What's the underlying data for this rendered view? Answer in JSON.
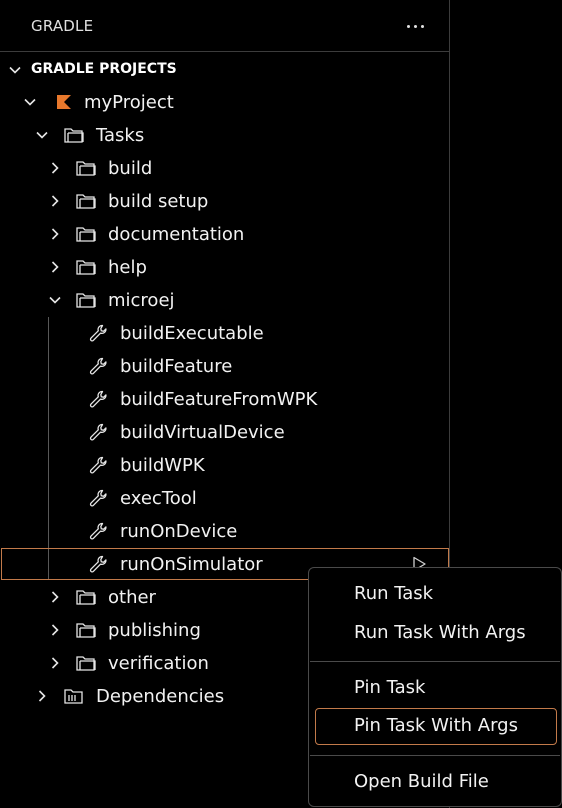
{
  "panel": {
    "title": "GRADLE",
    "more_icon": "ellipsis-icon"
  },
  "section": {
    "title": "GRADLE PROJECTS"
  },
  "tree": {
    "project": "myProject",
    "tasks": "Tasks",
    "groups": {
      "build": "build",
      "build_setup": "build setup",
      "documentation": "documentation",
      "help": "help",
      "microej": "microej",
      "other": "other",
      "publishing": "publishing",
      "verification": "verification"
    },
    "microej_tasks": {
      "buildExecutable": "buildExecutable",
      "buildFeature": "buildFeature",
      "buildFeatureFromWPK": "buildFeatureFromWPK",
      "buildVirtualDevice": "buildVirtualDevice",
      "buildWPK": "buildWPK",
      "execTool": "execTool",
      "runOnDevice": "runOnDevice",
      "runOnSimulator": "runOnSimulator"
    },
    "dependencies": "Dependencies"
  },
  "context_menu": {
    "run_task": "Run Task",
    "run_task_with_args": "Run Task With Args",
    "pin_task": "Pin Task",
    "pin_task_with_args": "Pin Task With Args",
    "open_build_file": "Open Build File"
  },
  "colors": {
    "background": "#000000",
    "border": "#3c3c3c",
    "accent_focus": "#c27a4a",
    "kotlin_logo": "#e8782c",
    "text": "#f2f2f2"
  }
}
